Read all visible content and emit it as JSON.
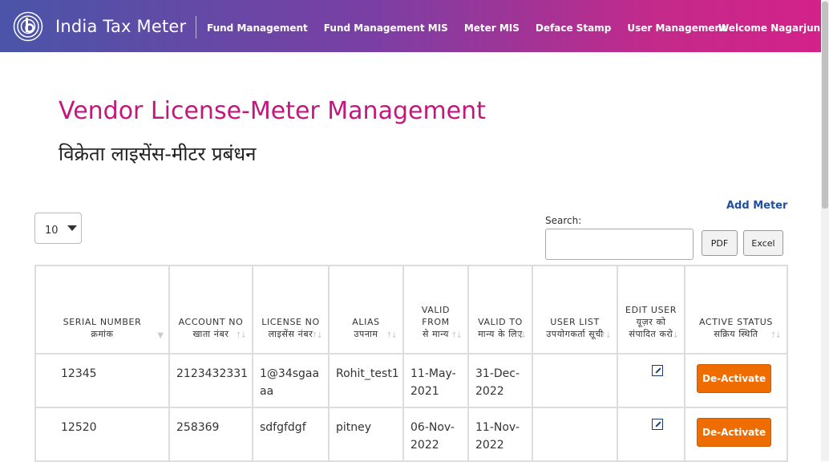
{
  "header": {
    "brand": "India Tax Meter",
    "nav": [
      "Fund Management",
      "Fund Management MIS",
      "Meter MIS",
      "Deface Stamp",
      "User Management"
    ],
    "welcome": "Welcome Nagarjun"
  },
  "page": {
    "title": "Vendor License-Meter Management",
    "subtitle": "विक्रेता लाइसेंस-मीटर प्रबंधन",
    "add_meter": "Add Meter"
  },
  "controls": {
    "page_length": "10",
    "search_label": "Search:",
    "search_value": "",
    "pdf_label": "PDF",
    "excel_label": "Excel"
  },
  "table": {
    "columns": [
      {
        "en": "SERIAL NUMBER",
        "hi": "क्रमांक"
      },
      {
        "en": "ACCOUNT NO",
        "hi": "खाता नंबर"
      },
      {
        "en": "LICENSE NO",
        "hi": "लाइसेंस नंबर"
      },
      {
        "en": "ALIAS",
        "hi": "उपनाम"
      },
      {
        "en": "VALID FROM",
        "hi": "से मान्य"
      },
      {
        "en": "VALID TO",
        "hi": "मान्य के लिए"
      },
      {
        "en": "USER LIST",
        "hi": "उपयोगकर्ता सूची"
      },
      {
        "en": "EDIT USER",
        "hi": "यूज़र को संपादित करो"
      },
      {
        "en": "ACTIVE STATUS",
        "hi": "सक्रिय स्थिति"
      }
    ],
    "rows": [
      {
        "serial": "12345",
        "account": "2123432331",
        "license": "1@34sgaaaa",
        "alias": "Rohit_test1",
        "from": "11-May-2021",
        "to": "31-Dec-2022",
        "user_list": "",
        "status_btn": "De-Activate"
      },
      {
        "serial": "12520",
        "account": "258369",
        "license": "sdfgfdgf",
        "alias": "pitney",
        "from": "06-Nov-2022",
        "to": "11-Nov-2022",
        "user_list": "",
        "status_btn": "De-Activate"
      }
    ]
  },
  "colors": {
    "brand_accent": "#c4177d",
    "link": "#1f4fa0",
    "action_button": "#ef6c00"
  }
}
